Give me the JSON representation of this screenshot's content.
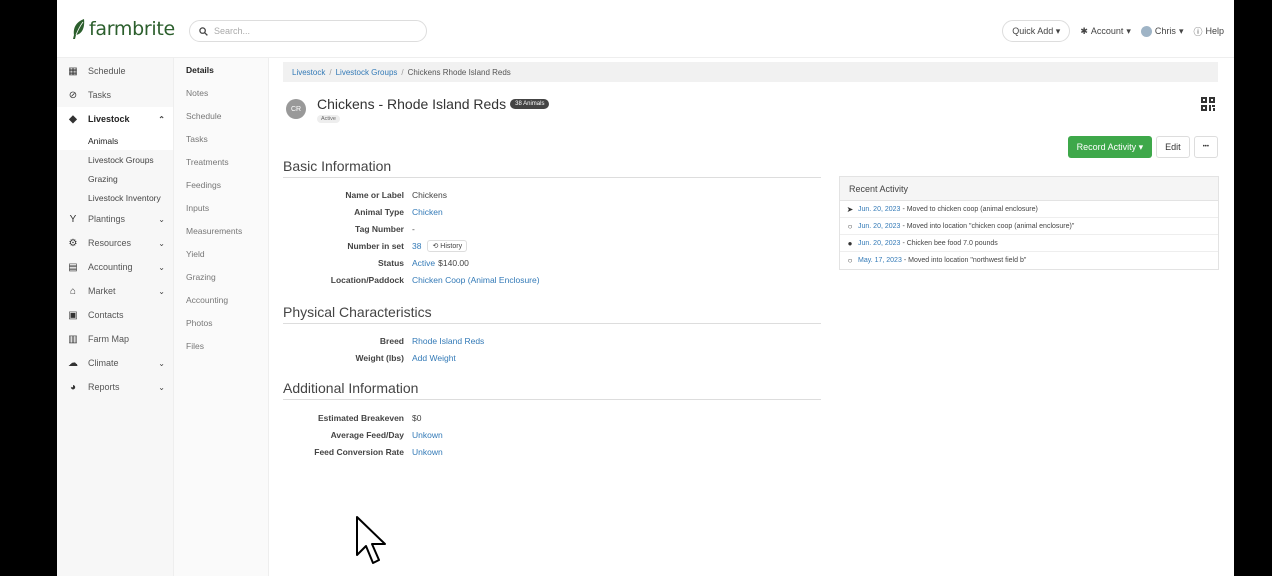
{
  "brand": {
    "name": "farmbrite",
    "color": "#2c5f2d",
    "accent": "#3ea84a"
  },
  "header": {
    "search_placeholder": "Search...",
    "quick_add": "Quick Add",
    "account": "Account",
    "user": "Chris",
    "help": "Help"
  },
  "nav": {
    "items": [
      {
        "label": "Schedule",
        "icon": "calendar-icon"
      },
      {
        "label": "Tasks",
        "icon": "check-circle-icon"
      },
      {
        "label": "Livestock",
        "icon": "livestock-icon",
        "expanded": true
      },
      {
        "label": "Plantings",
        "icon": "sprout-icon"
      },
      {
        "label": "Resources",
        "icon": "tractor-icon"
      },
      {
        "label": "Accounting",
        "icon": "calculator-icon"
      },
      {
        "label": "Market",
        "icon": "store-icon"
      },
      {
        "label": "Contacts",
        "icon": "contact-card-icon"
      },
      {
        "label": "Farm Map",
        "icon": "map-icon"
      },
      {
        "label": "Climate",
        "icon": "weather-icon"
      },
      {
        "label": "Reports",
        "icon": "pie-chart-icon"
      }
    ],
    "livestock_sub": [
      "Animals",
      "Livestock Groups",
      "Grazing",
      "Livestock Inventory"
    ]
  },
  "subnav": {
    "items": [
      "Details",
      "Notes",
      "Schedule",
      "Tasks",
      "Treatments",
      "Feedings",
      "Inputs",
      "Measurements",
      "Yield",
      "Grazing",
      "Accounting",
      "Photos",
      "Files"
    ]
  },
  "breadcrumb": {
    "items": [
      "Livestock",
      "Livestock Groups",
      "Chickens Rhode Island Reds"
    ]
  },
  "record": {
    "initials": "CR",
    "title": "Chickens - Rhode Island Reds",
    "count_badge": "38 Animals",
    "status": "Active"
  },
  "actions": {
    "record_activity": "Record Activity",
    "edit": "Edit",
    "more": "•••"
  },
  "basic": {
    "title": "Basic Information",
    "name_label": "Name or Label",
    "name_value": "Chickens",
    "type_label": "Animal Type",
    "type_value": "Chicken",
    "tag_label": "Tag Number",
    "tag_value": "-",
    "number_label": "Number in set",
    "number_value": "38",
    "history": "History",
    "status_label": "Status",
    "status_value": "Active",
    "status_price": "$140.00",
    "location_label": "Location/Paddock",
    "location_value": "Chicken Coop (Animal Enclosure)"
  },
  "physical": {
    "title": "Physical Characteristics",
    "breed_label": "Breed",
    "breed_value": "Rhode Island Reds",
    "weight_label": "Weight (lbs)",
    "weight_value": "Add Weight"
  },
  "additional": {
    "title": "Additional Information",
    "breakeven_label": "Estimated Breakeven",
    "breakeven_value": "$0",
    "feed_label": "Average Feed/Day",
    "feed_value": "Unkown",
    "fcr_label": "Feed Conversion Rate",
    "fcr_value": "Unkown"
  },
  "recent": {
    "title": "Recent Activity",
    "rows": [
      {
        "icon": "location-arrow-icon",
        "date": "Jun. 20, 2023",
        "text": " - Moved to chicken coop (animal enclosure)"
      },
      {
        "icon": "comment-icon",
        "date": "Jun. 20, 2023",
        "text": " - Moved into location \"chicken coop (animal enclosure)\""
      },
      {
        "icon": "feed-icon",
        "date": "Jun. 20, 2023",
        "text": " - Chicken bee food 7.0 pounds"
      },
      {
        "icon": "comment-icon",
        "date": "May. 17, 2023",
        "text": " - Moved into location \"northwest field b\""
      }
    ]
  }
}
